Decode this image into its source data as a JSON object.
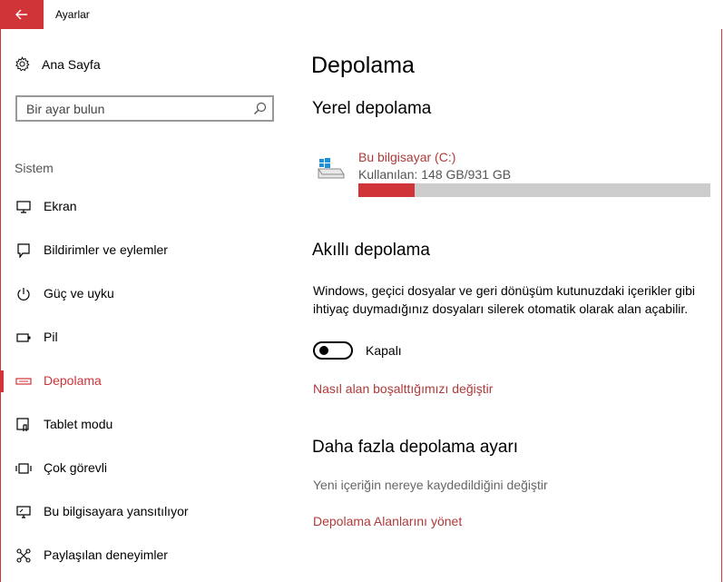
{
  "window": {
    "title": "Ayarlar",
    "accent": "#d13438"
  },
  "sidebar": {
    "home_label": "Ana Sayfa",
    "search_placeholder": "Bir ayar bulun",
    "section_label": "Sistem",
    "items": [
      {
        "label": "Ekran",
        "icon": "monitor-icon",
        "active": false
      },
      {
        "label": "Bildirimler ve eylemler",
        "icon": "notification-icon",
        "active": false
      },
      {
        "label": "Güç ve uyku",
        "icon": "power-icon",
        "active": false
      },
      {
        "label": "Pil",
        "icon": "battery-icon",
        "active": false
      },
      {
        "label": "Depolama",
        "icon": "storage-icon",
        "active": true
      },
      {
        "label": "Tablet modu",
        "icon": "tablet-mode-icon",
        "active": false
      },
      {
        "label": "Çok görevli",
        "icon": "multitasking-icon",
        "active": false
      },
      {
        "label": "Bu bilgisayara yansıtılıyor",
        "icon": "projecting-icon",
        "active": false
      },
      {
        "label": "Paylaşılan deneyimler",
        "icon": "shared-experiences-icon",
        "active": false
      }
    ]
  },
  "main": {
    "title": "Depolama",
    "local_storage": {
      "heading": "Yerel depolama",
      "drive": {
        "name": "Bu bilgisayar (C:)",
        "usage_text": "Kullanılan: 148 GB/931 GB",
        "used_fraction": 0.159
      }
    },
    "smart_storage": {
      "heading": "Akıllı depolama",
      "description": "Windows, geçici dosyalar ve geri dönüşüm kutunuzdaki içerikler gibi ihtiyaç duymadığınız dosyaları silerek otomatik olarak alan açabilir.",
      "toggle_state": "Kapalı",
      "toggle_on": false,
      "link": "Nasıl alan boşalttığımızı değiştir"
    },
    "more_storage": {
      "heading": "Daha fazla depolama ayarı",
      "save_location_link": "Yeni içeriğin nereye kaydedildiğini değiştir",
      "manage_spaces_link": "Depolama Alanlarını yönet"
    }
  }
}
